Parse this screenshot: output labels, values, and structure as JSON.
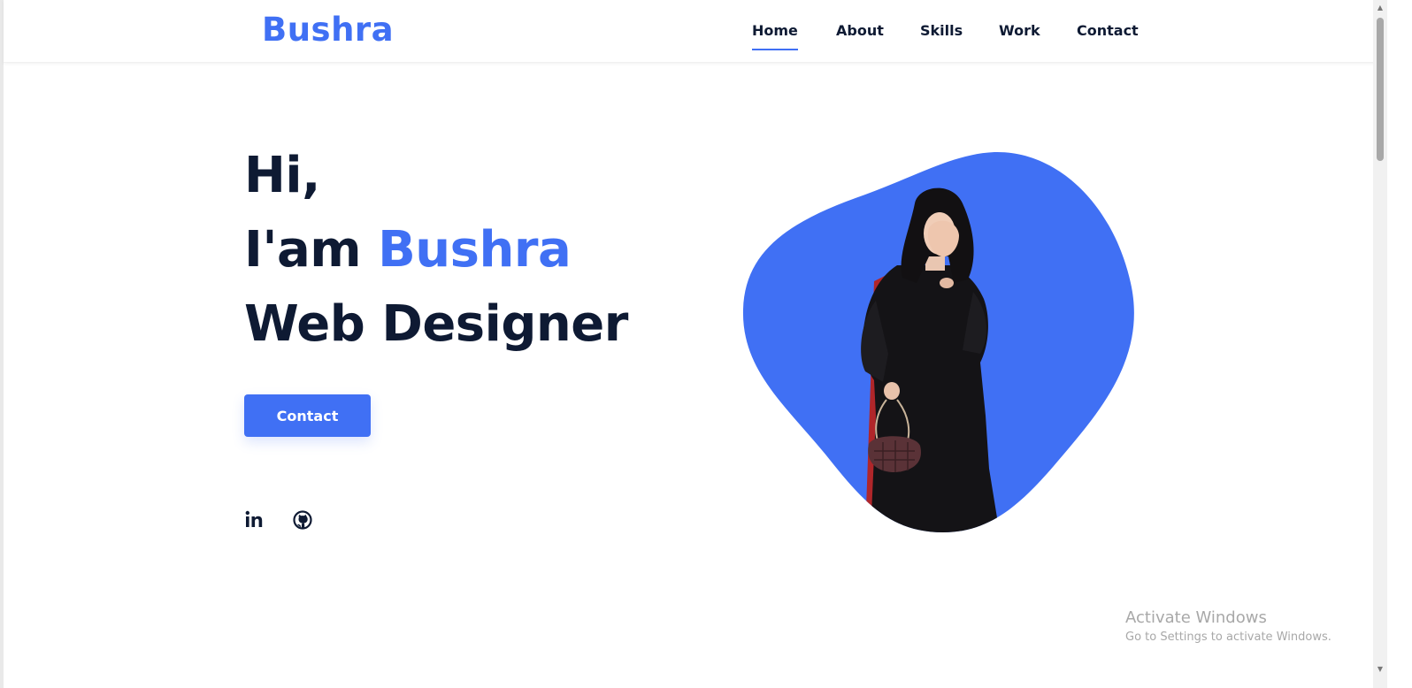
{
  "header": {
    "logo": "Bushra",
    "nav": [
      {
        "label": "Home",
        "active": true
      },
      {
        "label": "About",
        "active": false
      },
      {
        "label": "Skills",
        "active": false
      },
      {
        "label": "Work",
        "active": false
      },
      {
        "label": "Contact",
        "active": false
      }
    ]
  },
  "hero": {
    "line1": "Hi,",
    "line2_prefix": "I'am",
    "line2_name": "Bushra",
    "line3": "Web Designer",
    "button_label": "Contact",
    "social_icons": [
      "linkedin-icon",
      "github-icon"
    ]
  },
  "watermark": {
    "title": "Activate Windows",
    "subtitle": "Go to Settings to activate Windows."
  },
  "colors": {
    "accent": "#4070f4",
    "text": "#0e1a33",
    "background": "#ffffff"
  }
}
